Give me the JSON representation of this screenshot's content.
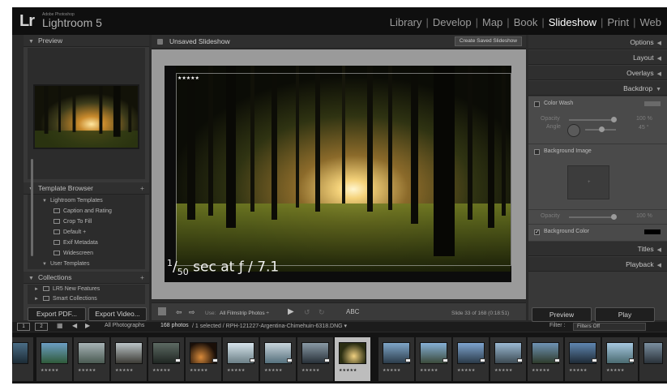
{
  "app": {
    "small_title": "Adobe Photoshop",
    "name": "Lightroom 5",
    "badge": "Lr"
  },
  "modules": [
    "Library",
    "Develop",
    "Map",
    "Book",
    "Slideshow",
    "Print",
    "Web"
  ],
  "active_module": "Slideshow",
  "left_panel": {
    "preview_header": "Preview",
    "template_browser_header": "Template Browser",
    "template_folder": "Lightroom Templates",
    "templates": [
      "Caption and Rating",
      "Crop To Fill",
      "Default +",
      "Exif Metadata",
      "Widescreen"
    ],
    "user_templates": "User Templates",
    "collections_header": "Collections",
    "collections": [
      "LR5 New Features",
      "Smart Collections"
    ],
    "export_pdf": "Export PDF...",
    "export_video": "Export Video..."
  },
  "center": {
    "slideshow_title": "Unsaved Slideshow",
    "create_saved": "Create Saved Slideshow",
    "stars": "★★★★★",
    "caption_num": "1",
    "caption_den": "50",
    "caption_rest": " sec at ƒ / 7.1",
    "toolbar": {
      "use_label": "Use:",
      "use_value": "All Filmstrip Photos ÷",
      "abc": "ABC",
      "slide_info": "Slide 33 of 168 (0:18:51)"
    }
  },
  "right_panel": {
    "sections": [
      "Options",
      "Layout",
      "Overlays",
      "Backdrop"
    ],
    "color_wash": "Color Wash",
    "opacity": "Opacity",
    "angle": "Angle",
    "opacity_value": "100 %",
    "angle_value": "45 °",
    "background_image": "Background Image",
    "bg_opacity_value": "100 %",
    "background_color": "Background Color",
    "titles": "Titles",
    "playback": "Playback",
    "preview_btn": "Preview",
    "play_btn": "Play"
  },
  "filmstrip_bar": {
    "screen1": "1",
    "screen2": "2",
    "source": "All Photographs",
    "count": "168 photos",
    "selection": " / 1 selected / RPH-121227-Argentina-Chimehuin-6318.DNG ▾",
    "filter_label": "Filter :",
    "filter_value": "Filters Off"
  },
  "thumb_stars": "★★★★★",
  "colors": {
    "accent_active": "#ffffff",
    "panel": "#383838",
    "stage": "#9a9a9a"
  }
}
